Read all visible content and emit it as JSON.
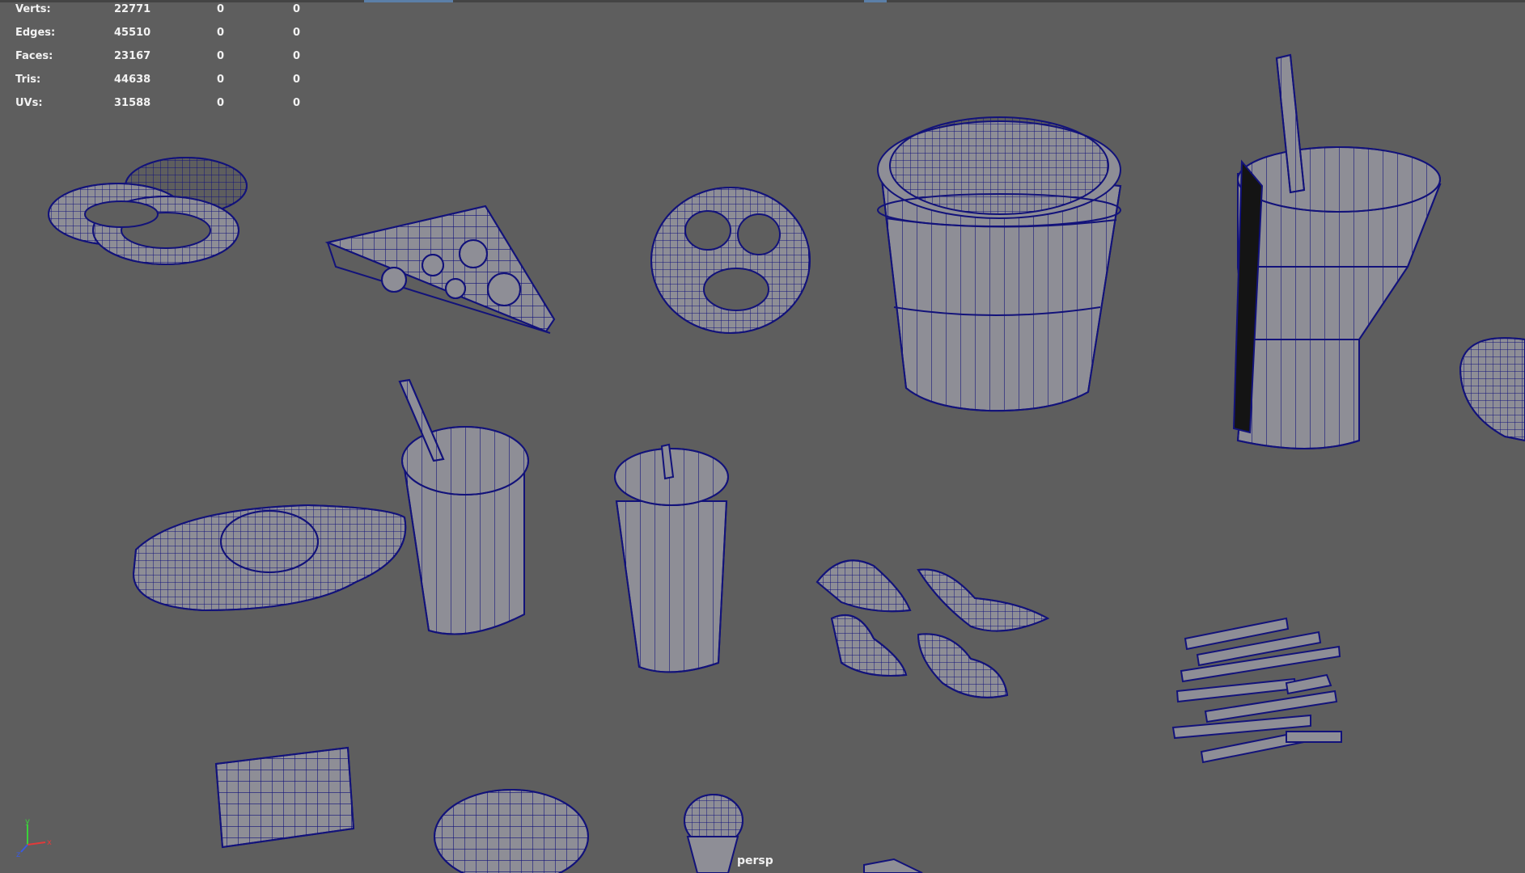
{
  "hud": {
    "rows": [
      {
        "label": "Verts:",
        "values": [
          "22771",
          "0",
          "0"
        ]
      },
      {
        "label": "Edges:",
        "values": [
          "45510",
          "0",
          "0"
        ]
      },
      {
        "label": "Faces:",
        "values": [
          "23167",
          "0",
          "0"
        ]
      },
      {
        "label": "Tris:",
        "values": [
          "44638",
          "0",
          "0"
        ]
      },
      {
        "label": "UVs:",
        "values": [
          "31588",
          "0",
          "0"
        ]
      }
    ]
  },
  "camera": {
    "label": "persp"
  },
  "axis": {
    "y": "y",
    "z": "z",
    "x": "x"
  },
  "colors": {
    "viewport_bg": "#5e5e5e",
    "mesh_fill": "#8e8e96",
    "wire": "#12127a",
    "hud_text": "#f2f2f2",
    "axis_x": "#e23a3a",
    "axis_y": "#3ad23a",
    "axis_z": "#3a5ae2"
  }
}
